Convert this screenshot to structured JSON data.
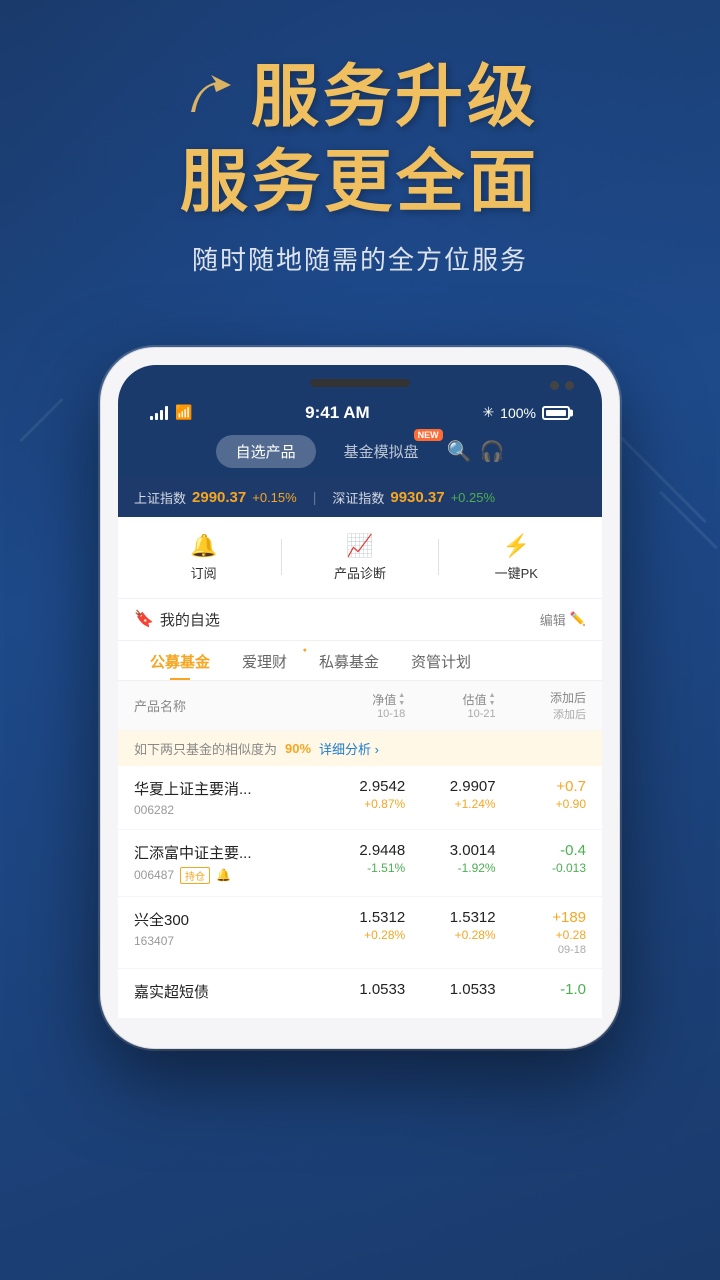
{
  "hero": {
    "line1": "服务升级",
    "line2": "服务更全面",
    "subtitle": "随时随地随需的全方位服务",
    "arrow": "↗"
  },
  "status_bar": {
    "time": "9:41 AM",
    "battery": "100%",
    "bluetooth": "✳"
  },
  "app_tabs": {
    "tab1": "自选产品",
    "tab2": "基金模拟盘",
    "new_badge": "NEW"
  },
  "market": {
    "shanghai_label": "上证指数",
    "shanghai_val": "2990.37",
    "shanghai_chg": "+0.15%",
    "shenzhen_label": "深证指数",
    "shenzhen_val": "9930.37",
    "shenzhen_chg": "+0.25%"
  },
  "quick_actions": [
    {
      "icon": "🔔",
      "label": "订阅"
    },
    {
      "icon": "📊",
      "label": "产品诊断"
    },
    {
      "icon": "⚡",
      "label": "一键PK"
    }
  ],
  "watchlist": {
    "title": "我的自选",
    "edit": "编辑"
  },
  "fund_tabs": [
    {
      "label": "公募基金",
      "active": true,
      "dot": false
    },
    {
      "label": "爱理财",
      "active": false,
      "dot": true
    },
    {
      "label": "私募基金",
      "active": false,
      "dot": false
    },
    {
      "label": "资管计划",
      "active": false,
      "dot": false
    }
  ],
  "table_header": {
    "col1": "产品名称",
    "col2_top": "净值",
    "col2_bot": "10-18",
    "col3_top": "估值",
    "col3_bot": "10-21",
    "col4_top": "添加后",
    "col4_bot": "添加后"
  },
  "similarity": {
    "text": "如下两只基金的相似度为",
    "pct": "90%",
    "link": "详细分析 ›"
  },
  "funds": [
    {
      "name": "华夏上证主要消...",
      "code": "006282",
      "badge": "",
      "bell": false,
      "nav": "2.9542",
      "nav_chg": "+0.87%",
      "nav_chg_type": "pos",
      "est": "2.9907",
      "est_chg": "+1.24%",
      "est_chg_type": "pos",
      "add": "+0.7",
      "add_sub": "+0.90",
      "add_sub_type": "pos",
      "add_date": ""
    },
    {
      "name": "汇添富中证主要...",
      "code": "006487",
      "badge": "持仓",
      "bell": true,
      "nav": "2.9448",
      "nav_chg": "-1.51%",
      "nav_chg_type": "neg",
      "est": "3.0014",
      "est_chg": "-1.92%",
      "est_chg_type": "neg",
      "add": "-0.4",
      "add_sub": "-0.013",
      "add_sub_type": "neg",
      "add_date": ""
    },
    {
      "name": "兴全300",
      "code": "163407",
      "badge": "",
      "bell": false,
      "nav": "1.5312",
      "nav_chg": "+0.28%",
      "nav_chg_type": "pos",
      "est": "1.5312",
      "est_chg": "+0.28%",
      "est_chg_type": "pos",
      "add": "+189",
      "add_sub": "+0.28",
      "add_sub_type": "pos",
      "add_date": "09-18"
    },
    {
      "name": "嘉实超短债",
      "code": "",
      "badge": "",
      "bell": false,
      "nav": "1.0533",
      "nav_chg": "",
      "nav_chg_type": "pos",
      "est": "1.0533",
      "est_chg": "",
      "est_chg_type": "neg",
      "add": "-1.0",
      "add_sub": "",
      "add_sub_type": "neg",
      "add_date": ""
    }
  ]
}
